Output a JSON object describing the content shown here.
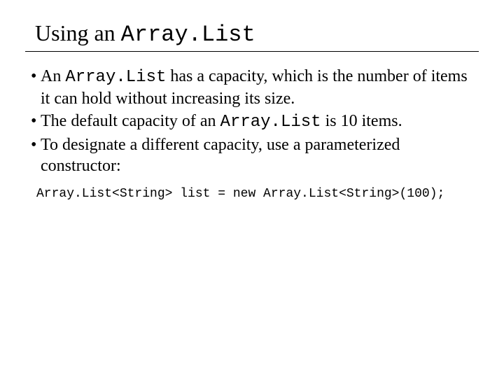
{
  "title": {
    "prefix": "Using an ",
    "code": "Array.List"
  },
  "bullets": [
    {
      "pre": "An ",
      "code": "Array.List",
      "post": " has a capacity, which is the number of items it can hold without increasing its size."
    },
    {
      "pre": "The default capacity of an ",
      "code": "Array.List",
      "post": " is 10 items."
    },
    {
      "pre": "To designate a different capacity, use a parameterized constructor:",
      "code": "",
      "post": ""
    }
  ],
  "code_example": "Array.List<String> list = new Array.List<String>(100);"
}
